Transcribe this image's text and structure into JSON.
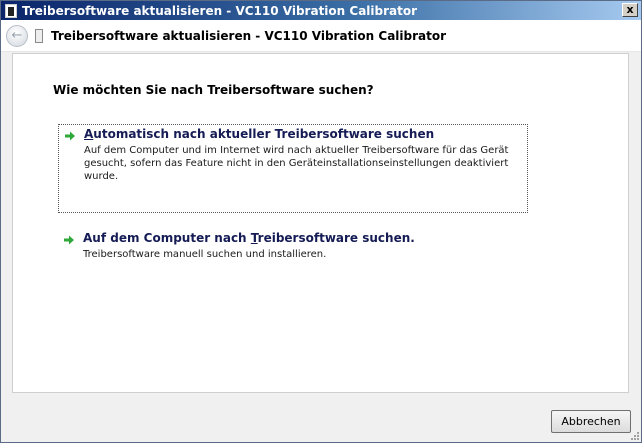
{
  "window": {
    "title": "Treibersoftware aktualisieren - VC110 Vibration Calibrator",
    "close_label": "x"
  },
  "nav": {
    "title": "Treibersoftware aktualisieren - VC110 Vibration Calibrator"
  },
  "content": {
    "question": "Wie möchten Sie nach Treibersoftware suchen?",
    "options": [
      {
        "title_pre": "",
        "title_ul": "A",
        "title_post": "utomatisch nach aktueller Treibersoftware suchen",
        "description": "Auf dem Computer und im Internet wird nach aktueller Treibersoftware für das Gerät gesucht, sofern das Feature nicht in den Geräteinstallationseinstellungen deaktiviert wurde."
      },
      {
        "title_pre": "Auf dem Computer nach ",
        "title_ul": "T",
        "title_post": "reibersoftware suchen.",
        "description": "Treibersoftware manuell suchen und installieren."
      }
    ]
  },
  "footer": {
    "cancel_label": "Abbrechen"
  },
  "colors": {
    "accent_arrow": "#2fa83a",
    "link_title": "#151c55"
  }
}
